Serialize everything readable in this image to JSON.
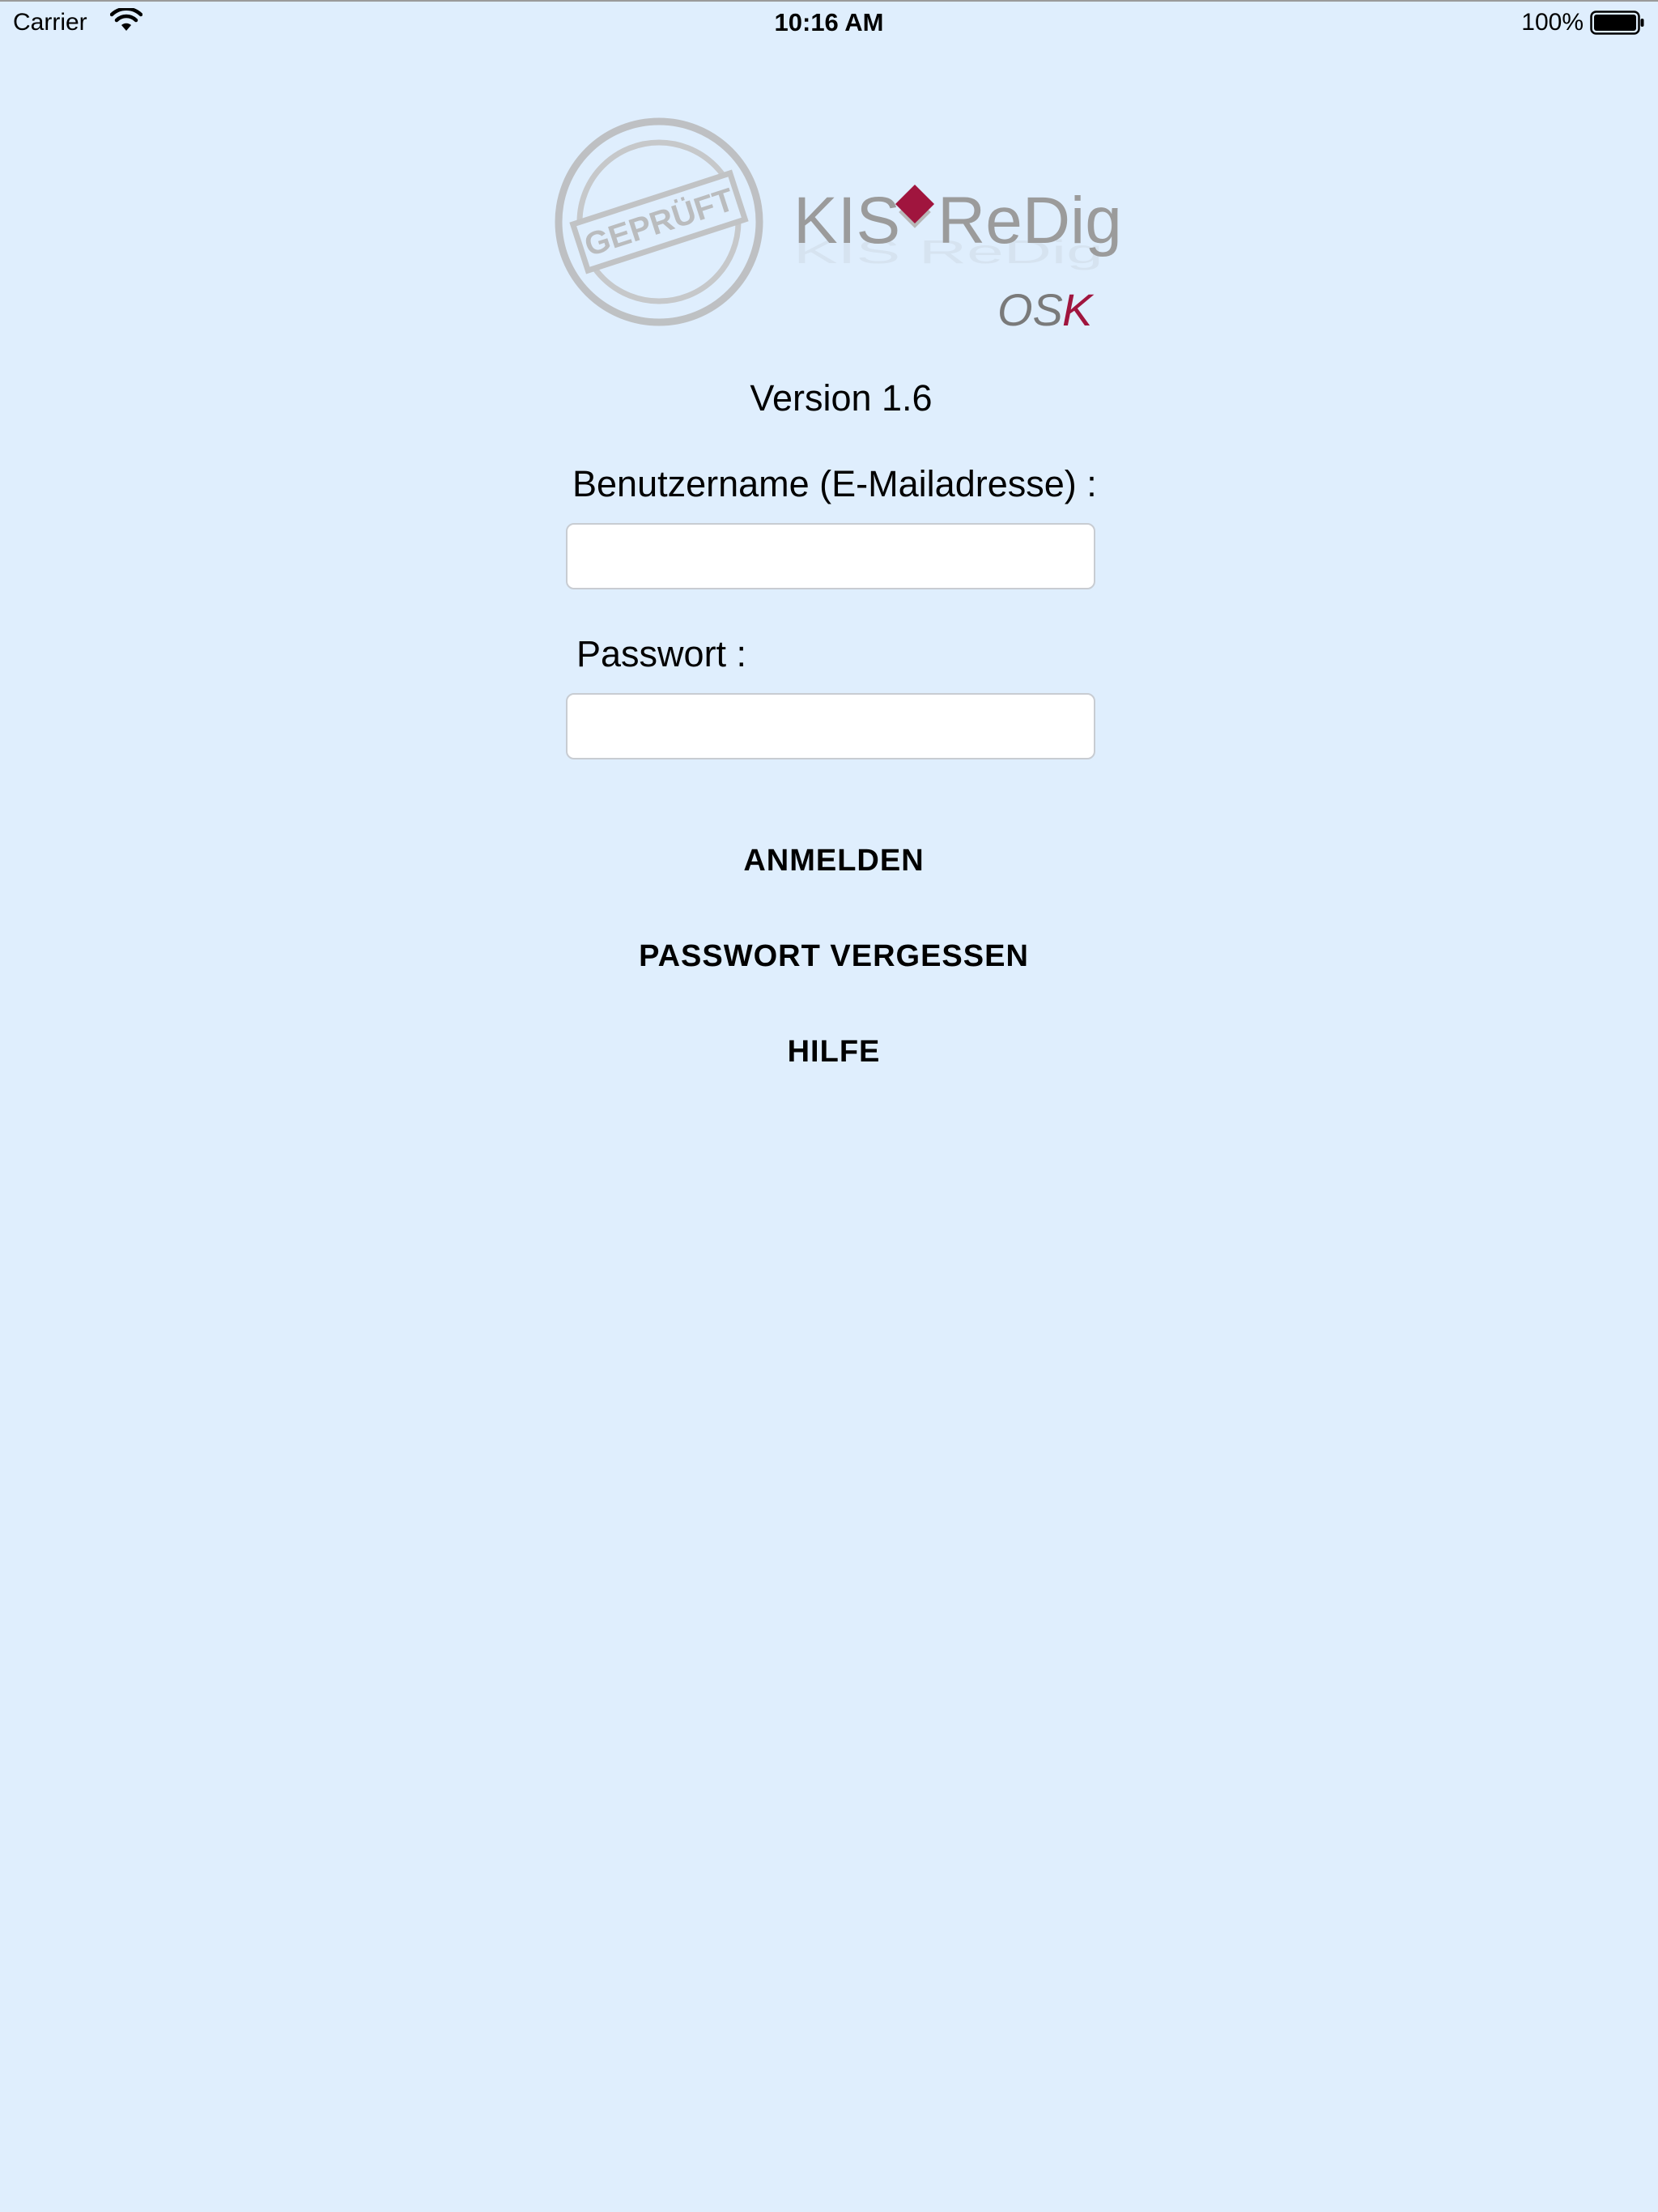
{
  "status_bar": {
    "carrier": "Carrier",
    "time": "10:16 AM",
    "battery_percent": "100%",
    "icons": [
      "wifi-icon",
      "battery-icon"
    ]
  },
  "logo": {
    "stamp_text": "GEPRÜFT",
    "product_left": "KIS",
    "product_right": "ReDig",
    "brand": "OSK",
    "accent_color": "#a0153e",
    "gray_color": "#9b9b9b"
  },
  "version_label": "Version 1.6",
  "form": {
    "username_label": "Benutzername (E-Mailadresse) :",
    "username_value": "",
    "password_label": "Passwort :",
    "password_value": ""
  },
  "buttons": {
    "login": "ANMELDEN",
    "forgot_password": "PASSWORT VERGESSEN",
    "help": "HILFE"
  },
  "colors": {
    "background": "#dfeefd",
    "field_background": "#ffffff",
    "text": "#000000"
  }
}
